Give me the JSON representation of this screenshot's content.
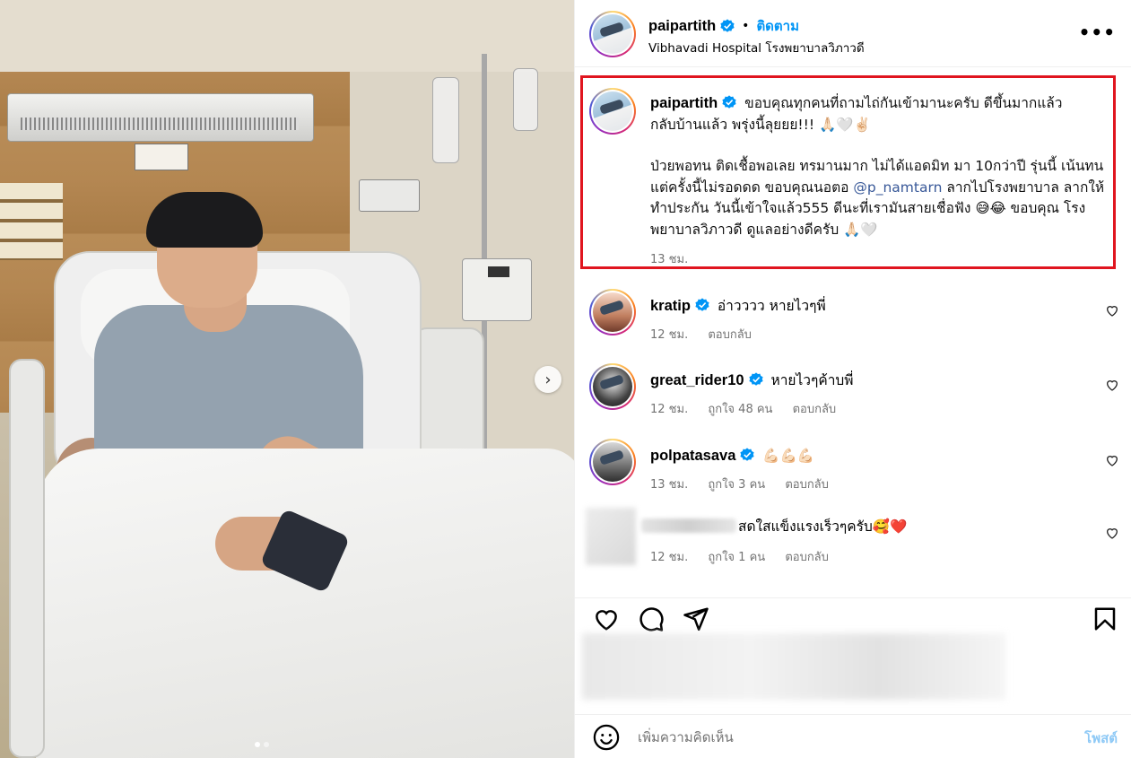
{
  "header": {
    "username": "paipartith",
    "separator": "•",
    "follow_label": "ติดตาม",
    "location": "Vibhavadi Hospital โรงพยาบาลวิภาวดี",
    "more_label": "•••"
  },
  "media": {
    "next_icon": "chevron-right-icon",
    "next_label": "›"
  },
  "caption": {
    "username": "paipartith",
    "line1": "ขอบคุณทุกคนที่ถามไถ่กันเข้ามานะครับ ดีขึ้นมากแล้ว",
    "line2": "กลับบ้านแล้ว พรุ่งนี้ลุยยย!!! 🙏🏻🤍✌🏻",
    "para2_part1": "ป่วยพอทน ติดเชื้อพอเลย ทรมานมาก ไม่ได้แอดมิท มา 10กว่าปี รุ่นนี้ เน้นทน แต่ครั้งนี้ไม่รอดดด ขอบคุณนอตอ ",
    "mention": "@p_namtarn",
    "para2_part2": " ลากไปโรงพยาบาล ลากให้ทำประกัน วันนี้เข้าใจแล้ว555 ดีนะที่เรามันสายเชื่อฟัง 😅😂 ขอบคุณ โรงพยาบาลวิภาวดี ดูแลอย่างดีครับ 🙏🏻🤍",
    "time": "13 ชม."
  },
  "comments": [
    {
      "username": "kratip",
      "text": "อ่าวววว หายไวๆพี่",
      "time": "12 ชม.",
      "likes": "",
      "reply": "ตอบกลับ"
    },
    {
      "username": "great_rider10",
      "text": "หายไวๆค้าบพี่",
      "time": "12 ชม.",
      "likes": "ถูกใจ 48 คน",
      "reply": "ตอบกลับ"
    },
    {
      "username": "polpatasava",
      "text": "💪🏻💪🏻💪🏻",
      "time": "13 ชม.",
      "likes": "ถูกใจ 3 คน",
      "reply": "ตอบกลับ"
    },
    {
      "username": "",
      "text": "สดใสแข็งแรงเร็วๆครับ🥰❤️",
      "time": "12 ชม.",
      "likes": "ถูกใจ 1 คน",
      "reply": "ตอบกลับ"
    }
  ],
  "add_comment": {
    "placeholder": "เพิ่มความคิดเห็น",
    "post_label": "โพสต์"
  },
  "colors": {
    "accent": "#0095f6",
    "highlight_box": "#e0151f",
    "verified": "#0095f6",
    "muted": "#737373"
  }
}
